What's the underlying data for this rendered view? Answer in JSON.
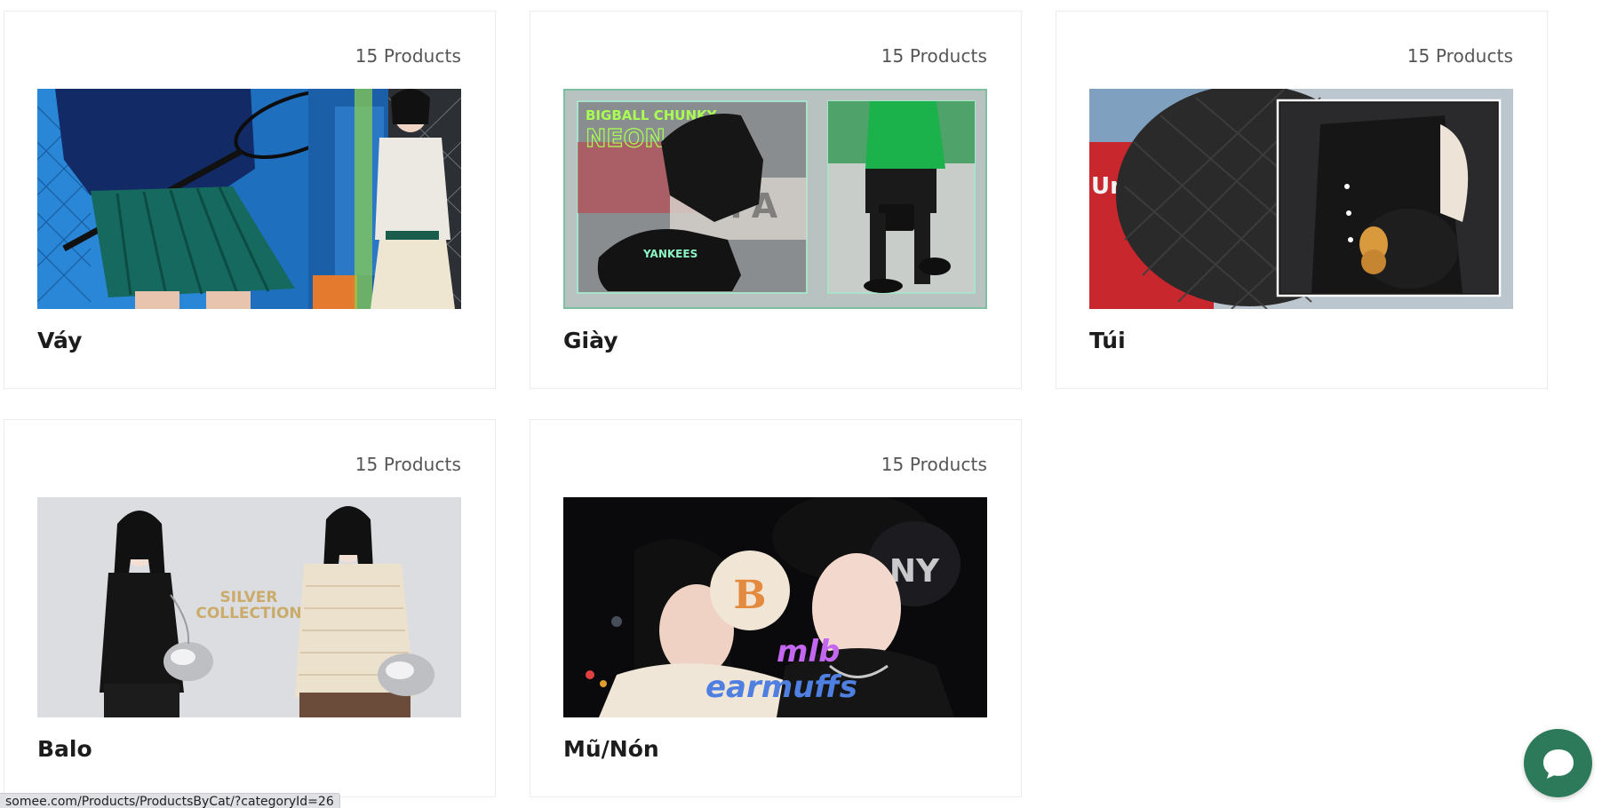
{
  "categories": [
    {
      "name": "Váy",
      "count": "15 Products",
      "image": "vay-banner"
    },
    {
      "name": "Giày",
      "count": "15 Products",
      "image": "giay-banner"
    },
    {
      "name": "Túi",
      "count": "15 Products",
      "image": "tui-banner"
    },
    {
      "name": "Balo",
      "count": "15 Products",
      "image": "balo-banner"
    },
    {
      "name": "Mũ/Nón",
      "count": "15 Products",
      "image": "mu-non-banner"
    }
  ],
  "banner_text": {
    "giay_line1": "BIGBALL CHUNKY",
    "giay_line2": "NEON",
    "giay_line3": "YANKEES",
    "tui_partial": "Un",
    "balo_line1": "SILVER",
    "balo_line2": "COLLECTION",
    "mu_line1": "mlb",
    "mu_line2": "earmuffs"
  },
  "status_bar": {
    "url": "somee.com/Products/ProductsByCat/?categoryId=26"
  },
  "chat": {
    "icon": "chat-bubble-icon",
    "color": "#2d7a5b"
  }
}
